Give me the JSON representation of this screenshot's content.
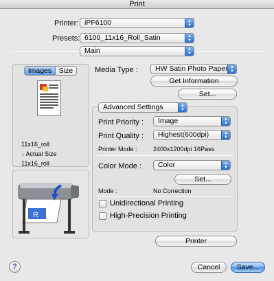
{
  "window": {
    "title": "Print"
  },
  "printer": {
    "label": "Printer:",
    "value": "iPF6100"
  },
  "presets": {
    "label": "Presets:",
    "value": "6100_11x16_Roll_Satin"
  },
  "panel": {
    "value": "Main"
  },
  "preview": {
    "tabs": [
      {
        "label": "Images",
        "selected": true
      },
      {
        "label": "Size",
        "selected": false
      }
    ],
    "paper_size": "11x16_roll",
    "actual_size_label": "Actual Size",
    "output_size": "11x16_roll"
  },
  "media": {
    "label": "Media Type :",
    "value": "HW Satin Photo Paper",
    "get_info_button": "Get Information",
    "set_button": "Set..."
  },
  "advanced": {
    "title": "Advanced Settings",
    "print_priority": {
      "label": "Print Priority :",
      "value": "Image"
    },
    "print_quality": {
      "label": "Print Quality :",
      "value": "Highest(600dpi)"
    },
    "printer_mode": {
      "label": "Printer Mode :",
      "value": "2400x1200dpi 16Pass"
    },
    "color_mode": {
      "label": "Color Mode :",
      "value": "Color"
    },
    "set_button": "Set...",
    "mode": {
      "label": "Mode :",
      "value": "No Correction"
    },
    "unidirectional": {
      "label": "Unidirectional Printing",
      "checked": false
    },
    "high_precision": {
      "label": "High-Precision Printing",
      "checked": false
    }
  },
  "printer_button": "Printer",
  "footer": {
    "help": "?",
    "cancel": "Cancel",
    "save": "Save..."
  },
  "colors": {
    "accent": "#4a8fe0",
    "arrow_blue": "#1f4fc4"
  }
}
